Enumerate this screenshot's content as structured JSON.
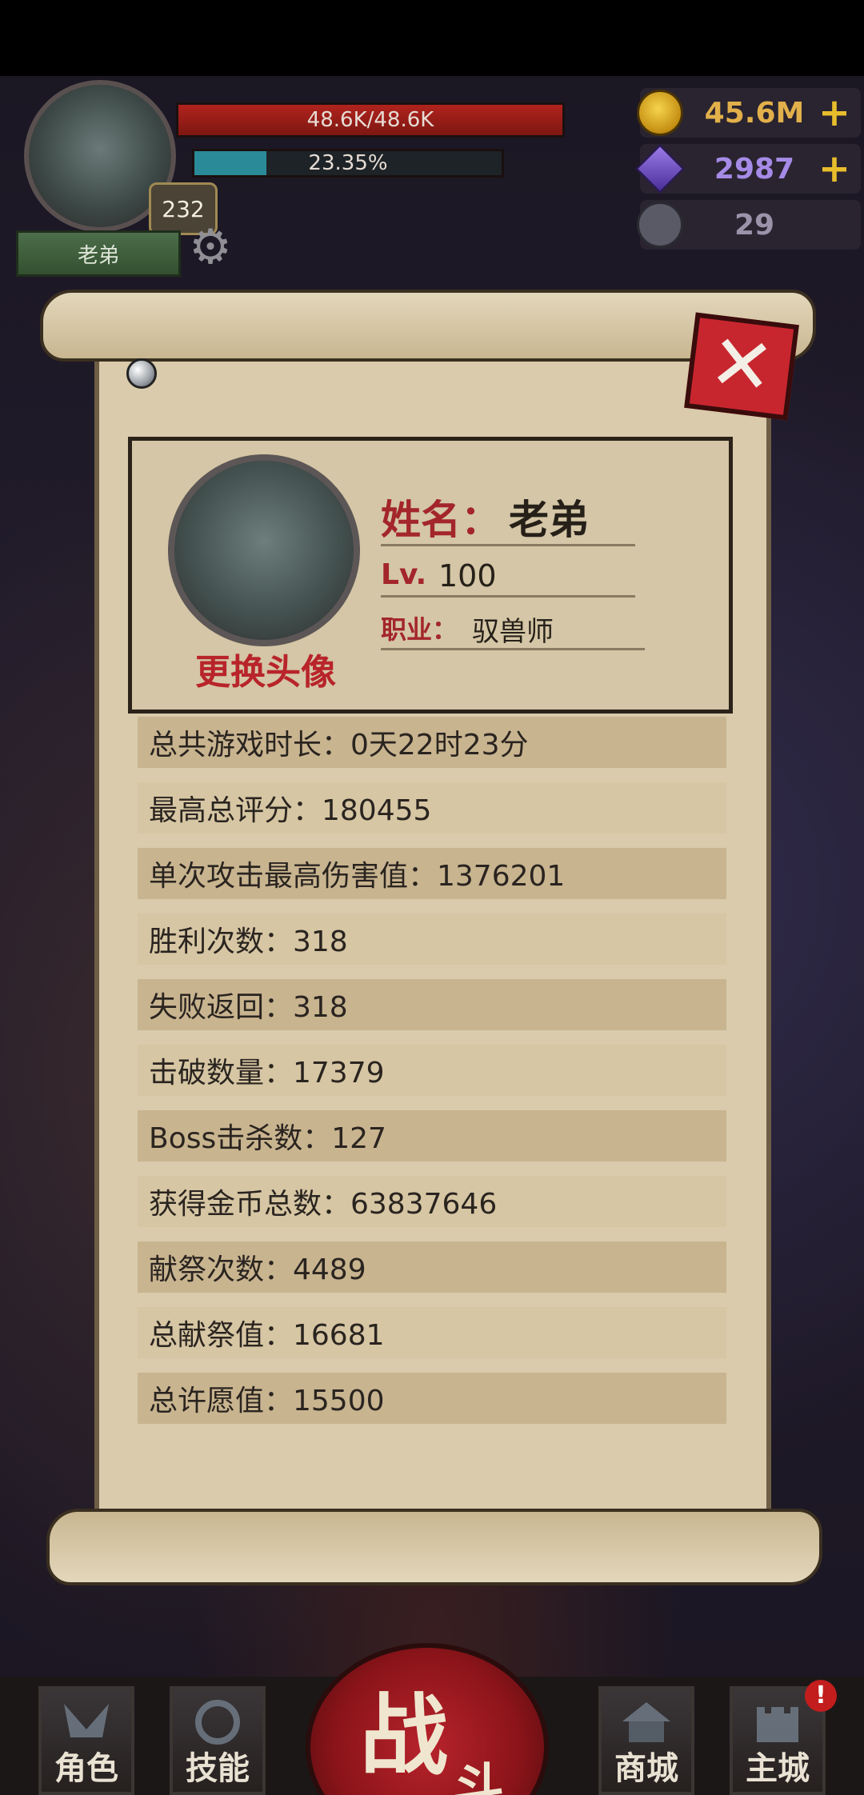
{
  "hud": {
    "player_name": "老弟",
    "player_level": "232",
    "hp_text": "48.6K/48.6K",
    "xp_text": "23.35%",
    "xp_progress": 0.2335
  },
  "resources": {
    "gold": "45.6M",
    "gems": "2987",
    "skulls": "29"
  },
  "profile": {
    "name_label": "姓名：",
    "name_value": "老弟",
    "level_label": "Lv.",
    "level_value": "100",
    "job_label": "职业：",
    "job_value": "驭兽师",
    "change_avatar": "更换头像"
  },
  "stats": [
    "总共游戏时长：0天22时23分",
    "最高总评分：180455",
    "单次攻击最高伤害值：1376201",
    "胜利次数：318",
    "失败返回：318",
    "击破数量：17379",
    "Boss击杀数：127",
    "获得金币总数：63837646",
    "献祭次数：4489",
    "总献祭值：16681",
    "总许愿值：15500"
  ],
  "nav": {
    "role": "角色",
    "skill": "技能",
    "battle_big": "战",
    "battle_small": "斗",
    "shop": "商城",
    "city": "主城",
    "city_badge": "!"
  },
  "colors": {
    "hp": "#b1231d",
    "xp": "#2a8a98",
    "gold_text": "#e2b04a",
    "gem_text": "#a58be6",
    "skull_text": "#9b93aa",
    "accent_red": "#b8242a",
    "parchment": "#d9cbab"
  }
}
